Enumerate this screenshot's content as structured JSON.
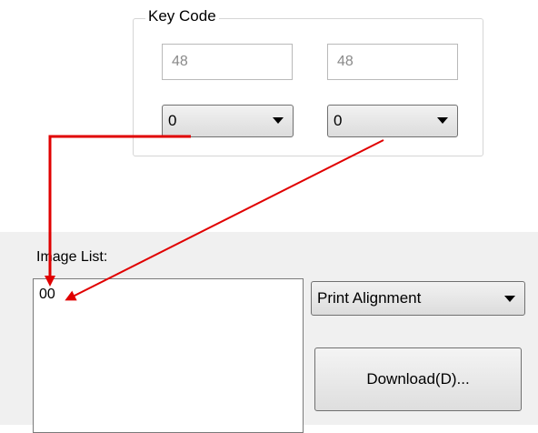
{
  "key_code": {
    "caption": "Key Code",
    "field_left": "48",
    "field_right": "48",
    "combo_left": "0",
    "combo_right": "0"
  },
  "image_list": {
    "label": "Image List:",
    "items": [
      "00"
    ]
  },
  "print_alignment": {
    "value": "Print Alignment"
  },
  "download_button": {
    "label": "Download(D)..."
  },
  "colors": {
    "annotation_arrow": "#e00000",
    "panel": "#f0f0f0"
  }
}
